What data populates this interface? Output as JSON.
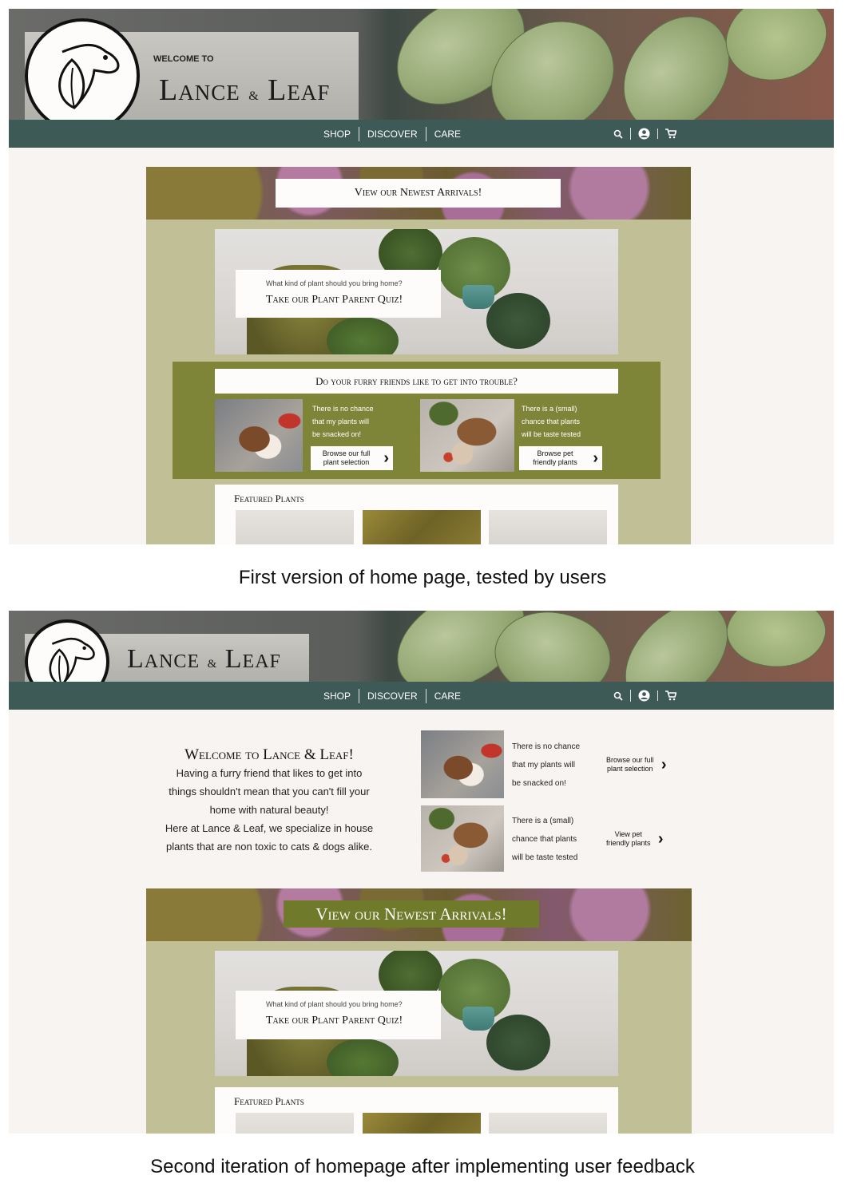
{
  "header": {
    "welcome_to": "WELCOME TO",
    "brand": "Lance & Leaf",
    "brand_main": "Lance",
    "brand_amp": "&",
    "brand_end": "Leaf"
  },
  "nav": {
    "links": [
      "SHOP",
      "DISCOVER",
      "CARE"
    ],
    "icons": [
      "search-icon",
      "account-icon",
      "cart-icon"
    ]
  },
  "v1": {
    "arrivals": "View our Newest Arrivals!",
    "quiz_question": "What kind of plant should you bring home?",
    "quiz_title": "Take our Plant Parent Quiz!",
    "pet_heading": "Do your furry friends like to get into trouble?",
    "pet1_text": [
      "There is no chance",
      "that my plants will",
      "be snacked on!"
    ],
    "pet1_button": [
      "Browse our full",
      "plant selection"
    ],
    "pet2_text": [
      "There is a (small)",
      "chance that plants",
      "will be taste tested"
    ],
    "pet2_button": [
      "Browse pet",
      "friendly plants"
    ],
    "featured_title": "Featured Plants"
  },
  "v2": {
    "welcome_title": "Welcome to Lance & Leaf!",
    "welcome_lines": [
      "Having a furry friend that likes to get into",
      "things shouldn't mean that you can't fill your",
      "home with natural beauty!",
      "Here at Lance & Leaf, we specialize in house",
      "plants that are non toxic to cats & dogs alike."
    ],
    "pet1_text": [
      "There is no chance",
      "that my plants will",
      "be snacked on!"
    ],
    "pet1_button": [
      "Browse our full",
      "plant selection"
    ],
    "pet2_text": [
      "There is a (small)",
      "chance that plants",
      "will be taste tested"
    ],
    "pet2_button": [
      "View pet",
      "friendly plants"
    ],
    "arrivals": "View our Newest Arrivals!",
    "quiz_question": "What kind of plant should you bring home?",
    "quiz_title": "Take our Plant Parent Quiz!",
    "featured_title": "Featured Plants"
  },
  "captions": {
    "first": "First version of home page, tested by users",
    "second": "Second iteration of homepage after implementing user feedback"
  },
  "colors": {
    "nav": "#3e5a57",
    "content_bg": "#c0bf96",
    "pet_box": "#7f8538",
    "page_bg": "#f7f4f1"
  }
}
